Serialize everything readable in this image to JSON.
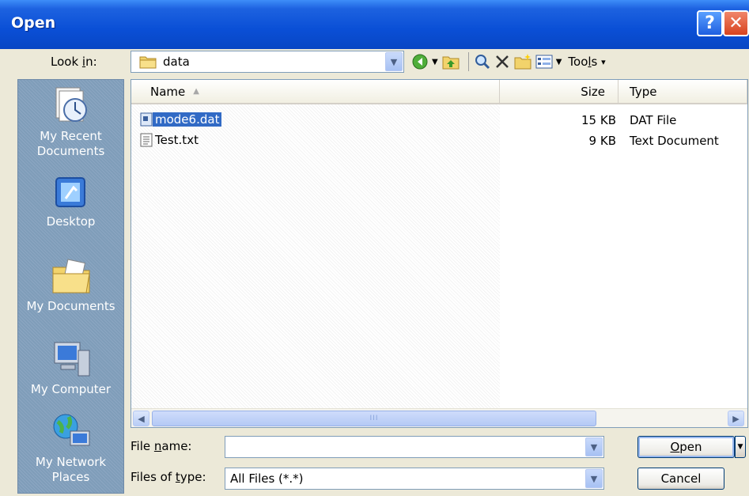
{
  "window": {
    "title": "Open"
  },
  "lookin": {
    "label_pre": "Look ",
    "label_u": "i",
    "label_post": "n:",
    "value": "data"
  },
  "toolbar": {
    "tools_pre": "Too",
    "tools_u": "l",
    "tools_post": "s",
    "tools_arrow": "▾"
  },
  "places": [
    {
      "label": "My Recent Documents",
      "icon": "recent-documents-icon"
    },
    {
      "label": "Desktop",
      "icon": "desktop-icon"
    },
    {
      "label": "My Documents",
      "icon": "my-documents-icon"
    },
    {
      "label": "My Computer",
      "icon": "my-computer-icon"
    },
    {
      "label": "My Network Places",
      "icon": "network-places-icon"
    }
  ],
  "columns": {
    "name": "Name",
    "size": "Size",
    "type": "Type"
  },
  "files": [
    {
      "name": "mode6.dat",
      "size": "15 KB",
      "type": "DAT File",
      "selected": true
    },
    {
      "name": "Test.txt",
      "size": "9 KB",
      "type": "Text Document",
      "selected": false
    }
  ],
  "scroll": {
    "grip": "III",
    "left_arrow": "◀",
    "right_arrow": "▶"
  },
  "filename": {
    "label_pre": "File ",
    "label_u": "n",
    "label_post": "ame:",
    "value": ""
  },
  "filetype": {
    "label_pre": "Files of ",
    "label_u": "t",
    "label_post": "ype:",
    "value": "All Files (*.*)"
  },
  "buttons": {
    "open_u": "O",
    "open_post": "pen",
    "cancel": "Cancel"
  },
  "titlebar_buttons": {
    "help": "?",
    "close": "✕"
  },
  "colors": {
    "titlebar": "#0a4fd6",
    "selection": "#316ac5",
    "places_bg": "#7f9db9"
  }
}
